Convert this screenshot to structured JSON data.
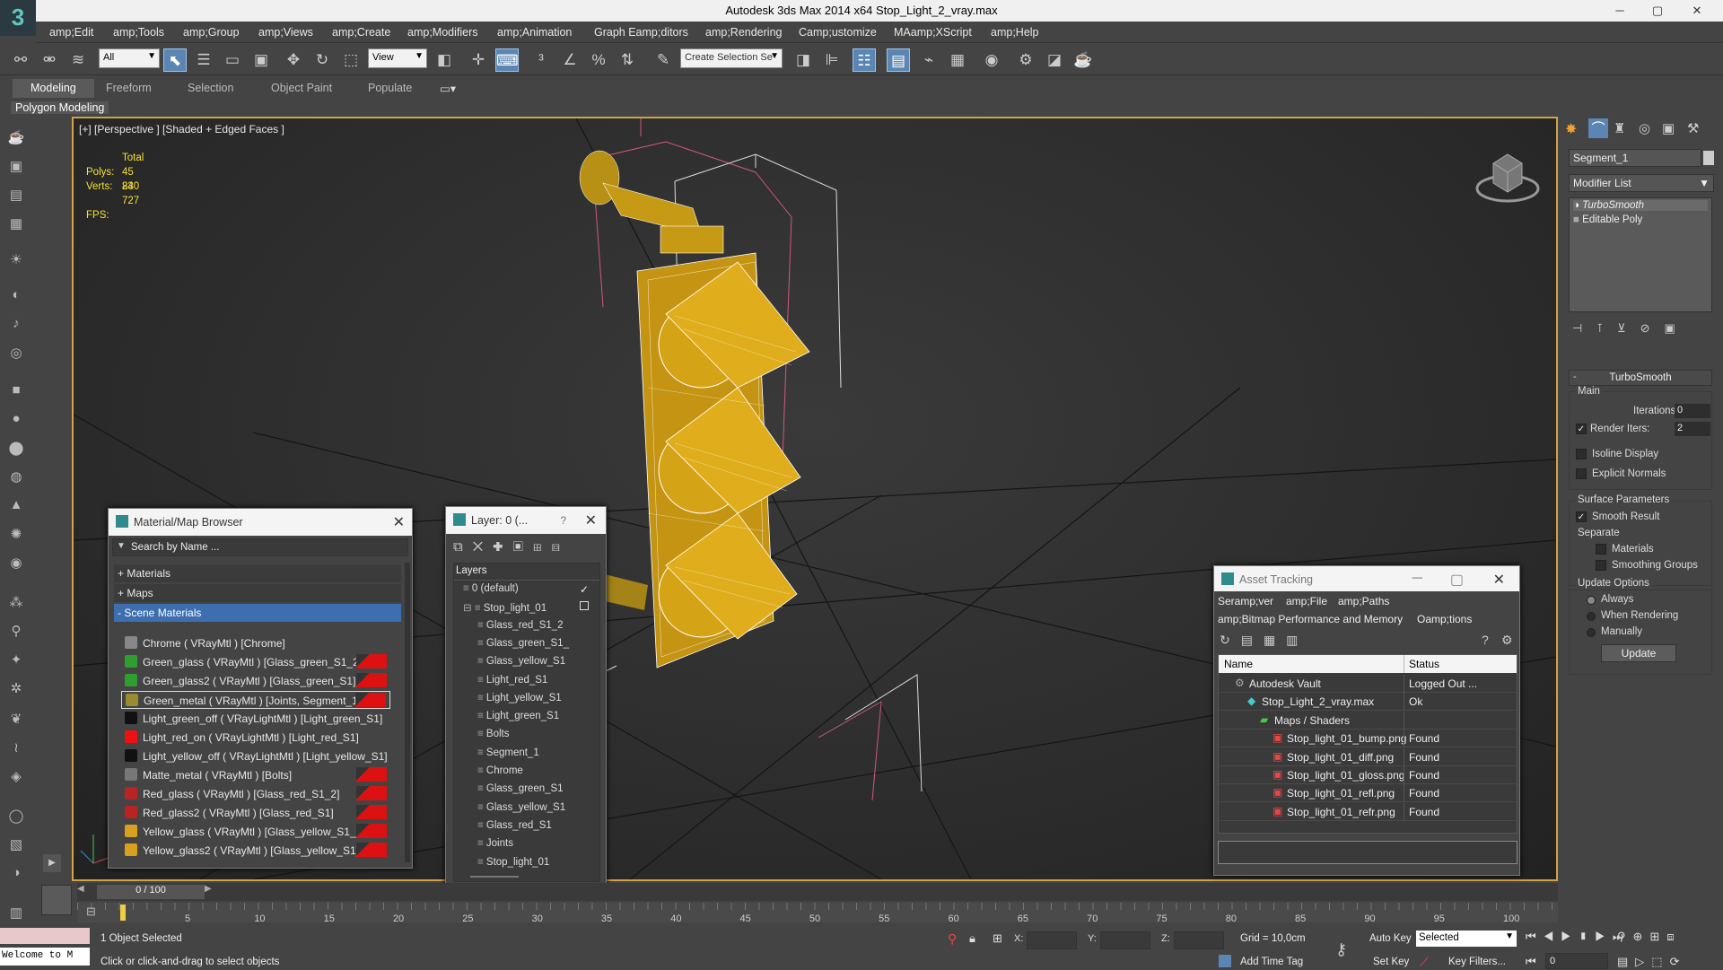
{
  "app": {
    "title": "Autodesk 3ds Max  2014 x64    Stop_Light_2_vray.max",
    "minimize": "─",
    "maximize": "▢",
    "close": "✕"
  },
  "menu": [
    "amp;Edit",
    "amp;Tools",
    "amp;Group",
    "amp;Views",
    "amp;Create",
    "amp;Modifiers",
    "amp;Animation",
    "Graph Eamp;ditors",
    "amp;Rendering",
    "Camp;ustomize",
    "MAamp;XScript",
    "amp;Help"
  ],
  "toolbar": {
    "filter_value": "All",
    "refcoord_value": "View",
    "selection_set_placeholder": "Create Selection Se"
  },
  "ribbon": {
    "tabs": [
      "Modeling",
      "Freeform",
      "Selection",
      "Object Paint",
      "Populate"
    ],
    "active": "Modeling",
    "panel_label": "Polygon Modeling"
  },
  "viewport": {
    "label": "[+] [Perspective ] [Shaded + Edged Faces ]",
    "stats_header": "Total",
    "polys_label": "Polys:",
    "polys_value": "45 830",
    "verts_label": "Verts:",
    "verts_value": "24 727",
    "fps_label": "FPS:"
  },
  "command_panel": {
    "object_name": "Segment_1",
    "modifier_list": "Modifier List",
    "stack": [
      "TurboSmooth",
      "Editable Poly"
    ],
    "rollout_title": "TurboSmooth",
    "main_label": "Main",
    "iterations_label": "Iterations:",
    "iterations_value": "0",
    "render_iters_label": "Render Iters:",
    "render_iters_value": "2",
    "render_iters_checked": true,
    "isoline_label": "Isoline Display",
    "explicit_normals_label": "Explicit Normals",
    "surface_params_label": "Surface Parameters",
    "smooth_result_label": "Smooth Result",
    "smooth_result_checked": true,
    "separate_label": "Separate",
    "materials_label": "Materials",
    "smoothing_groups_label": "Smoothing Groups",
    "update_options_label": "Update Options",
    "always_label": "Always",
    "when_rendering_label": "When Rendering",
    "manually_label": "Manually",
    "update_button": "Update"
  },
  "material_browser": {
    "title": "Material/Map Browser",
    "search_placeholder": "Search by Name ...",
    "groups": [
      "+ Materials",
      "+ Maps",
      "- Scene Materials"
    ],
    "items": [
      {
        "label": "Chrome  ( VRayMtl ) [Chrome]",
        "color": "#888888",
        "tag": false
      },
      {
        "label": "Green_glass  ( VRayMtl ) [Glass_green_S1_2]",
        "color": "#2e9e2e",
        "tag": true
      },
      {
        "label": "Green_glass2  ( VRayMtl ) [Glass_green_S1]",
        "color": "#2e9e2e",
        "tag": true
      },
      {
        "label": "Green_metal  ( VRayMtl ) [Joints, Segment_1]",
        "color": "#9a8a30",
        "tag": true
      },
      {
        "label": "Light_green_off  ( VRayLightMtl ) [Light_green_S1]",
        "color": "#111111",
        "tag": false
      },
      {
        "label": "Light_red_on  ( VRayLightMtl ) [Light_red_S1]",
        "color": "#ee1111",
        "tag": false
      },
      {
        "label": "Light_yellow_off  ( VRayLightMtl ) [Light_yellow_S1]",
        "color": "#111111",
        "tag": false
      },
      {
        "label": "Matte_metal  ( VRayMtl ) [Bolts]",
        "color": "#777777",
        "tag": true
      },
      {
        "label": "Red_glass  ( VRayMtl ) [Glass_red_S1_2]",
        "color": "#bb2222",
        "tag": true
      },
      {
        "label": "Red_glass2  ( VRayMtl ) [Glass_red_S1]",
        "color": "#bb2222",
        "tag": true
      },
      {
        "label": "Yellow_glass  ( VRayMtl ) [Glass_yellow_S1_2]",
        "color": "#d8a020",
        "tag": true
      },
      {
        "label": "Yellow_glass2  ( VRayMtl ) [Glass_yellow_S1]",
        "color": "#d8a020",
        "tag": true
      }
    ]
  },
  "layer_dialog": {
    "title": "Layer: 0 (...",
    "help": "?",
    "header": "Layers",
    "rows": [
      "0 (default)",
      "Stop_light_01",
      "Glass_red_S1_2",
      "Glass_green_S1_",
      "Glass_yellow_S1",
      "Light_red_S1",
      "Light_yellow_S1",
      "Light_green_S1",
      "Bolts",
      "Segment_1",
      "Chrome",
      "Glass_green_S1",
      "Glass_yellow_S1",
      "Glass_red_S1",
      "Joints",
      "Stop_light_01"
    ]
  },
  "asset_tracking": {
    "title": "Asset Tracking",
    "menu": [
      "Seramp;ver",
      "amp;File",
      "amp;Paths",
      "amp;Bitmap Performance and Memory",
      "Oamp;tions"
    ],
    "col_name": "Name",
    "col_status": "Status",
    "rows": [
      {
        "name": "Autodesk Vault",
        "status": "Logged Out ...",
        "indent": 0
      },
      {
        "name": "Stop_Light_2_vray.max",
        "status": "Ok",
        "indent": 1
      },
      {
        "name": "Maps / Shaders",
        "status": "",
        "indent": 2
      },
      {
        "name": "Stop_light_01_bump.png",
        "status": "Found",
        "indent": 3
      },
      {
        "name": "Stop_light_01_diff.png",
        "status": "Found",
        "indent": 3
      },
      {
        "name": "Stop_light_01_gloss.png",
        "status": "Found",
        "indent": 3
      },
      {
        "name": "Stop_light_01_refl.png",
        "status": "Found",
        "indent": 3
      },
      {
        "name": "Stop_light_01_refr.png",
        "status": "Found",
        "indent": 3
      }
    ]
  },
  "timeline": {
    "frame": "0 / 100",
    "ticks": [
      "5",
      "10",
      "15",
      "20",
      "25",
      "30",
      "35",
      "40",
      "45",
      "50",
      "55",
      "60",
      "65",
      "70",
      "75",
      "80",
      "85",
      "90",
      "95",
      "100"
    ]
  },
  "status": {
    "welcome": "Welcome to M",
    "selected": "1 Object Selected",
    "hint": "Click or click-and-drag to select objects",
    "x_label": "X:",
    "y_label": "Y:",
    "z_label": "Z:",
    "grid": "Grid = 10,0cm",
    "add_time_tag": "Add Time Tag",
    "auto_key": "Auto Key",
    "set_key": "Set Key",
    "selected_dropdown": "Selected",
    "key_filters": "Key Filters...",
    "frame_value": "0"
  }
}
